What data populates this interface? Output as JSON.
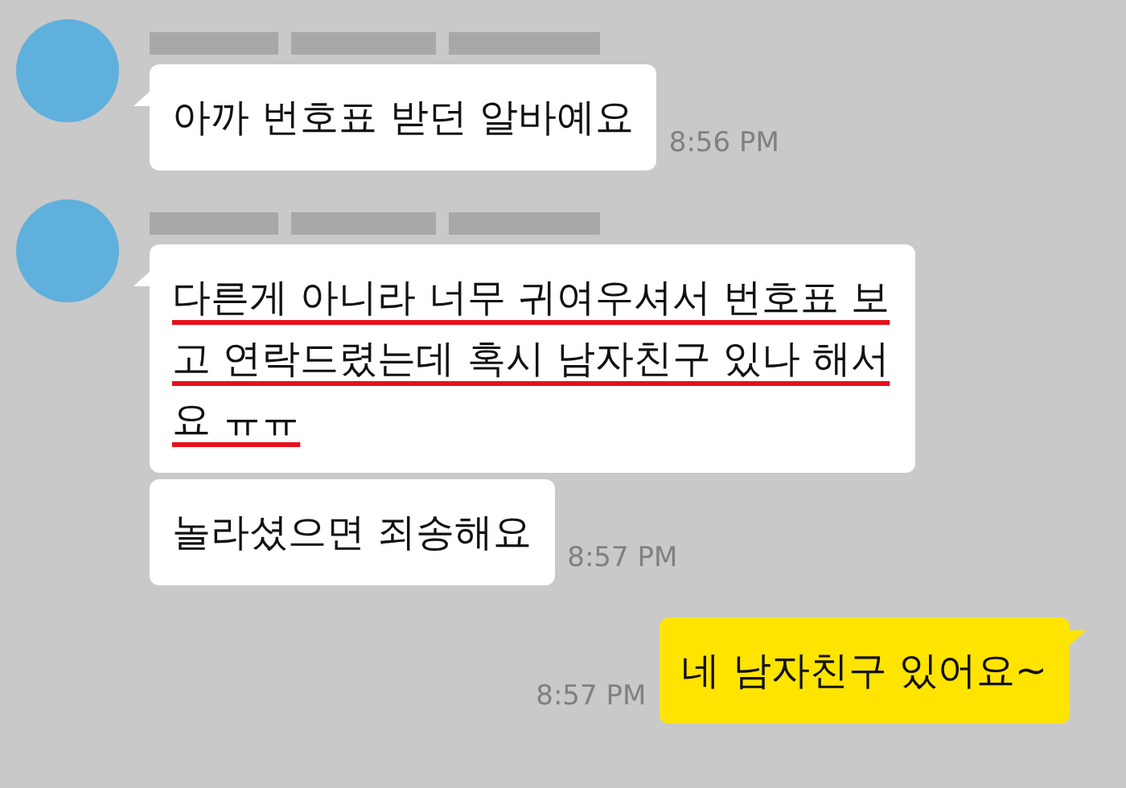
{
  "messages": [
    {
      "kind": "incoming",
      "bubbles": [
        {
          "text": "아까 번호표 받던 알바예요",
          "time": "8:56 PM",
          "underlined": false
        }
      ]
    },
    {
      "kind": "incoming",
      "bubbles": [
        {
          "text": "다른게 아니라 너무 귀여우셔서 번호표 보고 연락드렸는데 혹시 남자친구 있나 해서요 ㅠㅠ",
          "underlined": true
        },
        {
          "text": "놀라셨으면 죄송해요",
          "time": "8:57 PM",
          "underlined": false
        }
      ]
    },
    {
      "kind": "outgoing",
      "bubbles": [
        {
          "text": "네 남자친구 있어요~",
          "time": "8:57 PM",
          "underlined": false
        }
      ]
    }
  ]
}
